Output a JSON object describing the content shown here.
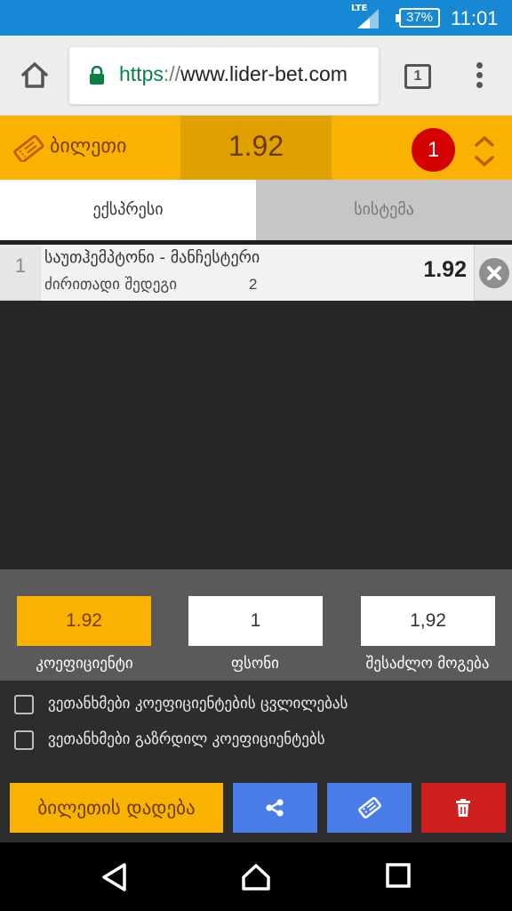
{
  "status_bar": {
    "network": "LTE",
    "battery": "37%",
    "time": "11:01"
  },
  "browser": {
    "url_scheme": "https",
    "url_separator": "://",
    "url_host": "www.lider-bet.com",
    "tab_count": "1"
  },
  "ticket": {
    "title": "ბილეთი",
    "total_odds": "1.92",
    "selection_count": "1"
  },
  "tabs": [
    {
      "label": "ექსპრესი",
      "active": true
    },
    {
      "label": "სისტემა",
      "active": false
    }
  ],
  "bets": [
    {
      "index": "1",
      "match": "საუთჰემპტონი - მანჩესტერი",
      "market": "ძირითადი შედეგი",
      "pick": "2",
      "odds": "1.92"
    }
  ],
  "stake_panel": {
    "odds_value": "1.92",
    "stake_value": "1",
    "possible_win_value": "1,92",
    "odds_label": "კოეფიციენტი",
    "stake_label": "ფსონი",
    "possible_win_label": "შესაძლო მოგება"
  },
  "options": [
    {
      "label": "ვეთანხმები კოეფიციენტების ცვლილებას",
      "checked": false
    },
    {
      "label": "ვეთანხმები გაზრდილ კოეფიციენტებს",
      "checked": false
    }
  ],
  "actions": {
    "place_bet_label": "ბილეთის დადება",
    "share_icon": "share-icon",
    "ticket_icon": "ticket-icon",
    "delete_icon": "trash-icon"
  },
  "colors": {
    "accent": "#f9b200",
    "action_blue": "#4a7de8",
    "danger_red": "#d01f1f",
    "badge_red": "#d40000"
  }
}
